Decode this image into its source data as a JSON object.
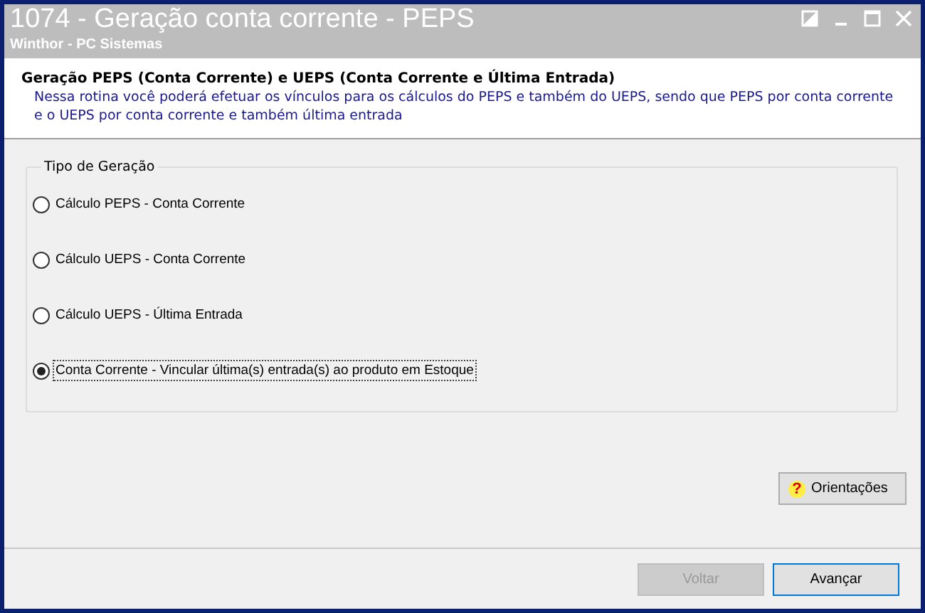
{
  "window": {
    "title": "1074 - Geração conta corrente - PEPS",
    "subtitle": "Winthor - PC Sistemas"
  },
  "header": {
    "title": "Geração PEPS (Conta Corrente) e UEPS (Conta Corrente e Última Entrada)",
    "description": "Nessa rotina você poderá efetuar os vínculos para os cálculos do PEPS e também do UEPS, sendo que PEPS por conta corrente e o UEPS por conta corrente e também última entrada"
  },
  "group": {
    "title": "Tipo de Geração",
    "options": [
      {
        "label": "Cálculo PEPS - Conta Corrente",
        "selected": false
      },
      {
        "label": "Cálculo UEPS - Conta Corrente",
        "selected": false
      },
      {
        "label": "Cálculo UEPS - Última Entrada",
        "selected": false
      },
      {
        "label": "Conta Corrente - Vincular última(s) entrada(s) ao produto em Estoque",
        "selected": true
      }
    ]
  },
  "help_button": {
    "label": "Orientações",
    "icon": "?"
  },
  "buttons": [
    {
      "label": "Voltar",
      "disabled": true
    },
    {
      "label": "Avançar",
      "disabled": false
    }
  ]
}
